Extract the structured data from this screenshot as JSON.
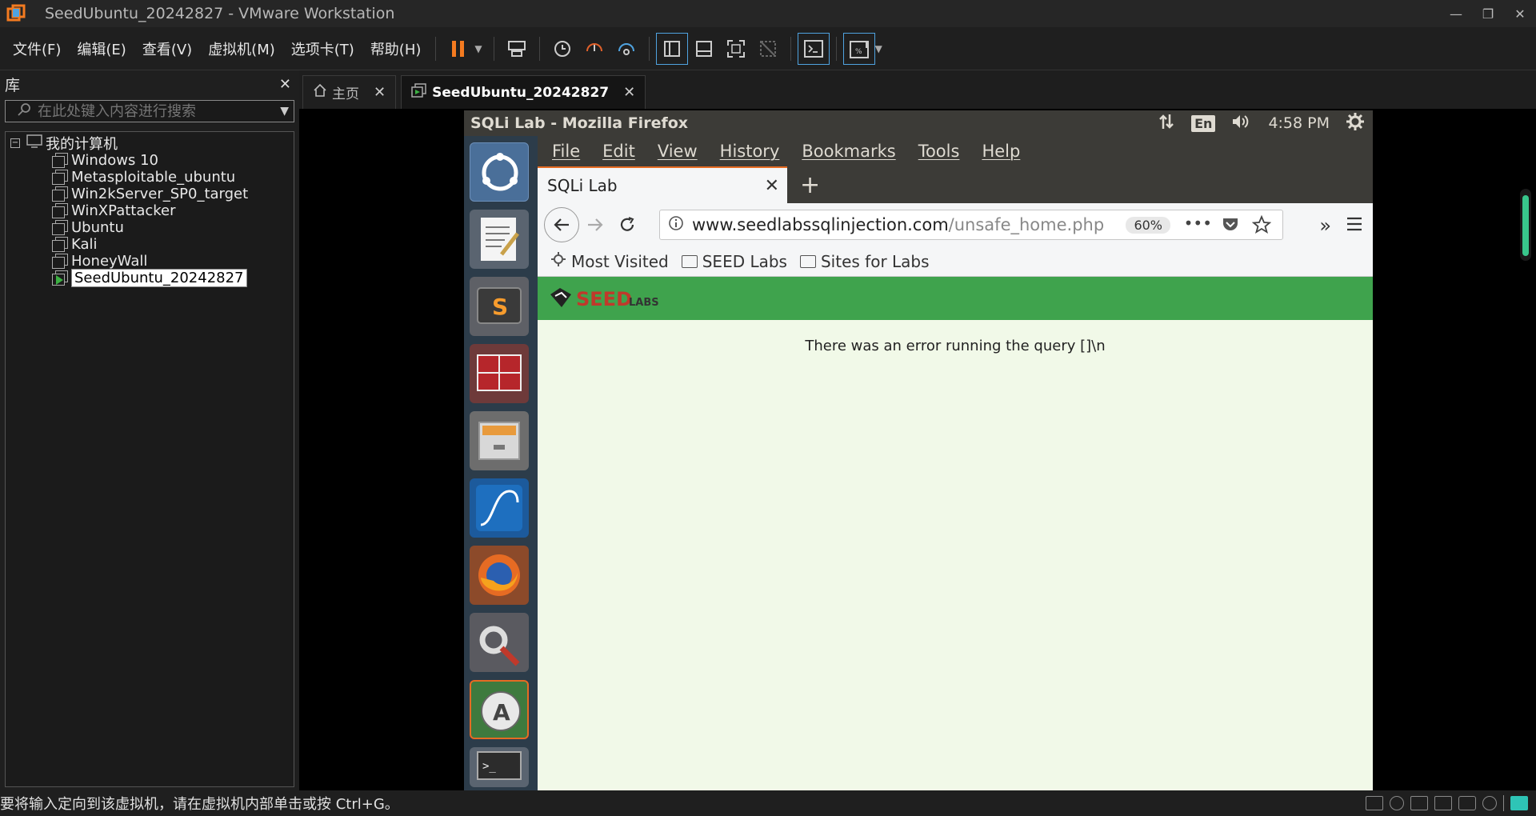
{
  "window": {
    "title": "SeedUbuntu_20242827 - VMware Workstation",
    "controls": [
      "—",
      "❐",
      "✕"
    ]
  },
  "menu": [
    "文件(F)",
    "编辑(E)",
    "查看(V)",
    "虚拟机(M)",
    "选项卡(T)",
    "帮助(H)"
  ],
  "library": {
    "title": "库",
    "close": "✕",
    "search_placeholder": "在此处键入内容进行搜索",
    "root": "我的计算机",
    "vms": [
      "Windows 10",
      "Metasploitable_ubuntu",
      "Win2kServer_SP0_target",
      "WinXPattacker",
      "Ubuntu",
      "Kali",
      "HoneyWall",
      "SeedUbuntu_20242827"
    ],
    "selected": "SeedUbuntu_20242827"
  },
  "tabs": [
    {
      "label": "主页",
      "close": "✕"
    },
    {
      "label": "SeedUbuntu_20242827",
      "close": "✕"
    }
  ],
  "guest": {
    "window_title": "SQLi Lab - Mozilla Firefox",
    "lang": "En",
    "time": "4:58 PM",
    "launcher_icons": [
      "ubuntu-dash-icon",
      "text-editor-icon",
      "sublime-text-icon",
      "terminal-red-icon",
      "file-manager-icon",
      "wireshark-icon",
      "firefox-icon",
      "system-settings-icon",
      "software-updater-icon",
      "terminal-icon"
    ]
  },
  "firefox": {
    "menu": [
      "File",
      "Edit",
      "View",
      "History",
      "Bookmarks",
      "Tools",
      "Help"
    ],
    "tab_title": "SQLi Lab",
    "tab_close": "✕",
    "new_tab": "+",
    "url_host": "www.seedlabssqlinjection.com",
    "url_path": "/unsafe_home.php",
    "zoom": "60%",
    "bookmarks": [
      "Most Visited",
      "SEED Labs",
      "Sites for Labs"
    ],
    "error_text": "There was an error running the query []\\n"
  },
  "statusbar": {
    "message": "要将输入定向到该虚拟机，请在虚拟机内部单击或按 Ctrl+G。"
  },
  "colors": {
    "accent_orange": "#f47b20",
    "seed_green": "#3fa34d",
    "page_bg": "#f1f9e8",
    "ubuntu_panel": "#3c3b37"
  }
}
